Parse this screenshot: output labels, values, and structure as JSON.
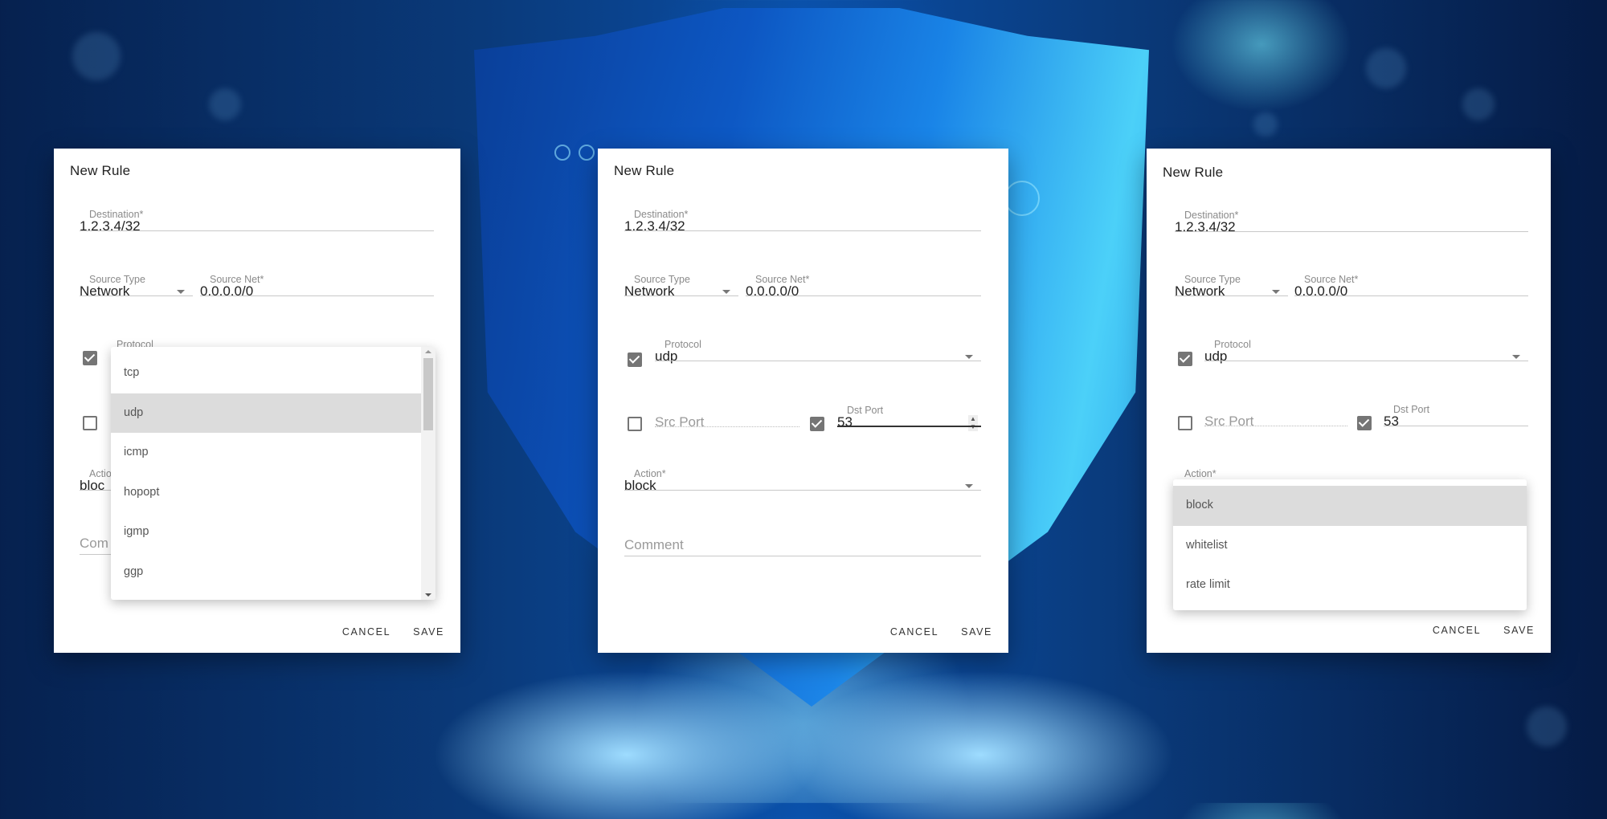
{
  "background": {
    "description": "shield-with-circuit-held-by-hands",
    "accent": "#0b63c7"
  },
  "dialogs": [
    {
      "title": "New Rule",
      "destination": {
        "label": "Destination*",
        "value": "1.2.3.4/32"
      },
      "source_type": {
        "label": "Source Type",
        "value": "Network"
      },
      "source_net": {
        "label": "Source Net*",
        "value": "0.0.0.0/0"
      },
      "protocol": {
        "label": "Protocol",
        "enabled": true,
        "value": "udp",
        "menu_open": true,
        "options": [
          "tcp",
          "udp",
          "icmp",
          "hopopt",
          "igmp",
          "ggp"
        ],
        "highlighted": "udp"
      },
      "src_port": {
        "enabled": false
      },
      "action": {
        "label_partial": "Actio",
        "value_partial": "bloc"
      },
      "comment": {
        "placeholder_partial": "Com"
      },
      "buttons": {
        "cancel": "CANCEL",
        "save": "SAVE"
      }
    },
    {
      "title": "New Rule",
      "destination": {
        "label": "Destination*",
        "value": "1.2.3.4/32"
      },
      "source_type": {
        "label": "Source Type",
        "value": "Network"
      },
      "source_net": {
        "label": "Source Net*",
        "value": "0.0.0.0/0"
      },
      "protocol": {
        "label": "Protocol",
        "enabled": true,
        "value": "udp"
      },
      "src_port": {
        "enabled": false,
        "placeholder": "Src Port"
      },
      "dst_port": {
        "enabled": true,
        "label": "Dst Port",
        "value": "53",
        "focused": true
      },
      "action": {
        "label": "Action*",
        "value": "block"
      },
      "comment": {
        "placeholder": "Comment"
      },
      "buttons": {
        "cancel": "CANCEL",
        "save": "SAVE"
      }
    },
    {
      "title": "New Rule",
      "destination": {
        "label": "Destination*",
        "value": "1.2.3.4/32"
      },
      "source_type": {
        "label": "Source Type",
        "value": "Network"
      },
      "source_net": {
        "label": "Source Net*",
        "value": "0.0.0.0/0"
      },
      "protocol": {
        "label": "Protocol",
        "enabled": true,
        "value": "udp"
      },
      "src_port": {
        "enabled": false,
        "placeholder": "Src Port"
      },
      "dst_port": {
        "enabled": true,
        "label": "Dst Port",
        "value": "53"
      },
      "action": {
        "label": "Action*",
        "menu_open": true,
        "options": [
          "block",
          "whitelist",
          "rate limit"
        ],
        "highlighted": "block"
      },
      "buttons": {
        "cancel": "CANCEL",
        "save": "SAVE"
      }
    }
  ]
}
